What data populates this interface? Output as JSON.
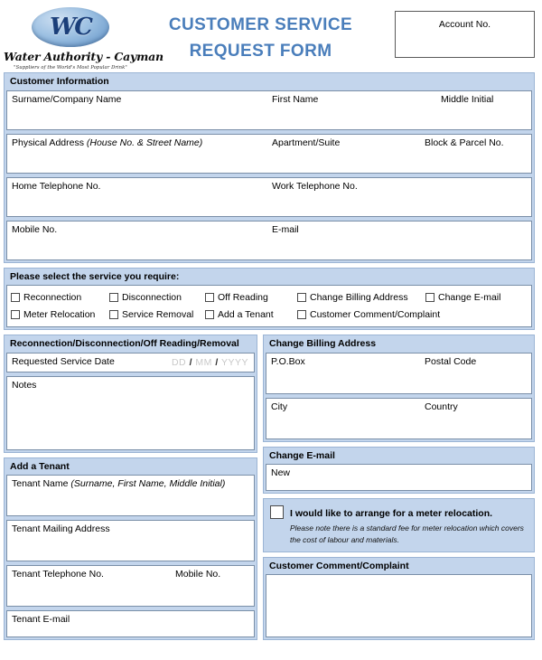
{
  "header": {
    "logo": {
      "monogram": "WC",
      "org_name": "Water Authority - Cayman",
      "tagline": "\"Suppliers of the World's Most Popular Drink\""
    },
    "title_line1": "CUSTOMER SERVICE",
    "title_line2": "REQUEST FORM",
    "account_label": "Account No.",
    "title_color": "#4a7ebb"
  },
  "customer_information": {
    "section_title": "Customer Information",
    "rows": [
      {
        "a": "Surname/Company Name",
        "b": "First Name",
        "c": "Middle Initial"
      },
      {
        "a_main": "Physical Address ",
        "a_italic": "(House No. & Street Name)",
        "b": "Apartment/Suite",
        "c": "Block & Parcel No."
      },
      {
        "a": "Home Telephone No.",
        "b": "Work Telephone No."
      },
      {
        "a": "Mobile No.",
        "b": "E-mail"
      }
    ]
  },
  "service_selection": {
    "section_title": "Please select the service you require:",
    "row1": [
      "Reconnection",
      "Disconnection",
      "Off Reading",
      "Change Billing Address",
      "Change E-mail"
    ],
    "row2": [
      "Meter Relocation",
      "Service Removal",
      "Add a Tenant",
      "Customer Comment/Complaint"
    ]
  },
  "reconnection": {
    "section_title": "Reconnection/Disconnection/Off Reading/Removal",
    "date_label": "Requested Service Date",
    "date_placeholder": {
      "dd": "DD",
      "sep1": "/",
      "mm": "MM",
      "sep2": "/",
      "yyyy": "YYYY"
    },
    "notes_label": "Notes"
  },
  "add_tenant": {
    "section_title": "Add a Tenant",
    "name_label": "Tenant Name ",
    "name_label_italic": "(Surname, First Name, Middle Initial)",
    "mailing_label": "Tenant Mailing Address",
    "telephone_label": "Tenant Telephone No.",
    "mobile_label": "Mobile No.",
    "email_label": "Tenant E-mail"
  },
  "change_billing_address": {
    "section_title": "Change Billing Address",
    "po_box_label": "P.O.Box",
    "postal_code_label": "Postal Code",
    "city_label": "City",
    "country_label": "Country"
  },
  "change_email": {
    "section_title": "Change E-mail",
    "new_label": "New"
  },
  "meter_relocation": {
    "statement": "I would like to arrange for a meter relocation.",
    "note": "Please note there is a standard fee for meter relocation which covers the cost of labour and materials."
  },
  "customer_comment": {
    "section_title": "Customer Comment/Complaint"
  }
}
